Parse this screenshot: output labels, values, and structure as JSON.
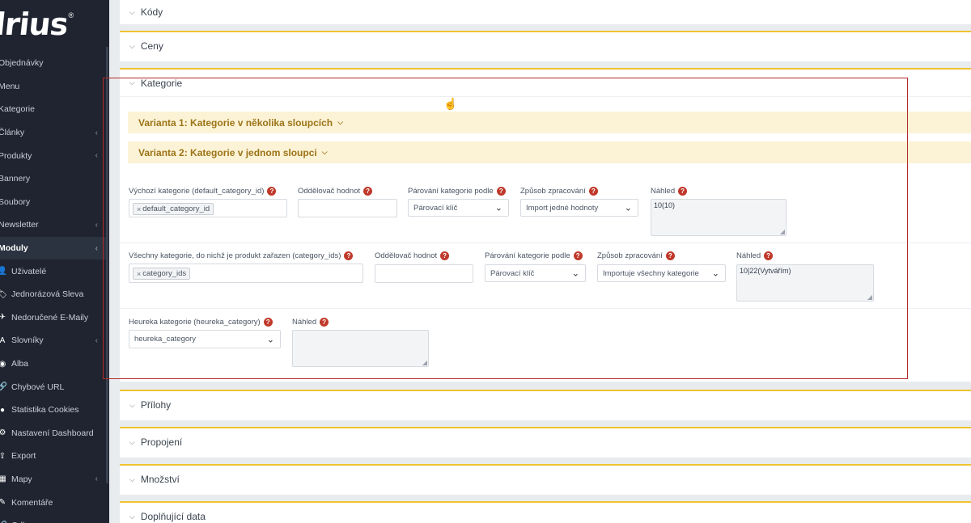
{
  "brand": {
    "logo_text": "lrius",
    "reg": "®"
  },
  "sidebar": {
    "items": [
      {
        "label": "Objednávky",
        "has_icon": false,
        "chevron": false
      },
      {
        "label": "Menu",
        "has_icon": false,
        "chevron": false
      },
      {
        "label": "Kategorie",
        "has_icon": false,
        "chevron": false
      },
      {
        "label": "Články",
        "has_icon": false,
        "chevron": true
      },
      {
        "label": "Produkty",
        "has_icon": false,
        "chevron": true
      },
      {
        "label": "Bannery",
        "has_icon": false,
        "chevron": false
      },
      {
        "label": "Soubory",
        "has_icon": false,
        "chevron": false
      },
      {
        "label": "Newsletter",
        "has_icon": false,
        "chevron": true
      },
      {
        "label": "Moduly",
        "has_icon": false,
        "chevron": true,
        "active": true
      },
      {
        "label": "Uživatelé",
        "has_icon": true,
        "icon": "user-icon",
        "chevron": false
      },
      {
        "label": "Jednorázová Sleva",
        "has_icon": true,
        "icon": "tag-icon",
        "chevron": false
      },
      {
        "label": "Nedoručené E-Maily",
        "has_icon": true,
        "icon": "send-icon",
        "chevron": false
      },
      {
        "label": "Slovníky",
        "has_icon": true,
        "icon": "translate-icon",
        "chevron": true
      },
      {
        "label": "Alba",
        "has_icon": true,
        "icon": "camera-icon",
        "chevron": false
      },
      {
        "label": "Chybové URL",
        "has_icon": true,
        "icon": "link-icon",
        "chevron": false
      },
      {
        "label": "Statistika Cookies",
        "has_icon": true,
        "icon": "cookie-icon",
        "chevron": false
      },
      {
        "label": "Nastavení Dashboard",
        "has_icon": true,
        "icon": "gear-icon",
        "chevron": false
      },
      {
        "label": "Export",
        "has_icon": true,
        "icon": "export-icon",
        "chevron": false
      },
      {
        "label": "Mapy",
        "has_icon": true,
        "icon": "map-icon",
        "chevron": true
      },
      {
        "label": "Komentáře",
        "has_icon": true,
        "icon": "comment-icon",
        "chevron": false
      },
      {
        "label": "Odkazy",
        "has_icon": true,
        "icon": "link-icon",
        "chevron": false
      }
    ]
  },
  "panels": {
    "kody": "Kódy",
    "ceny": "Ceny",
    "kategorie": "Kategorie",
    "prilohy": "Přílohy",
    "propojeni": "Propojení",
    "mnozstvi": "Množství",
    "doplnujici": "Doplňující data"
  },
  "variants": {
    "v1": "Varianta 1: Kategorie v několika sloupcích",
    "v2": "Varianta 2: Kategorie v jednom sloupci"
  },
  "row1": {
    "field_label": "Výchozí kategorie (default_category_id)",
    "tag": "default_category_id",
    "separator_label": "Oddělovač hodnot",
    "separator_value": "",
    "pairing_label": "Párování kategorie podle",
    "pairing_value": "Párovací klíč",
    "method_label": "Způsob zpracování",
    "method_value": "Import jedné hodnoty",
    "preview_label": "Náhled",
    "preview_value": "10(10)"
  },
  "row2": {
    "field_label": "Všechny kategorie, do nichž je produkt zařazen (category_ids)",
    "tag": "category_ids",
    "separator_label": "Oddělovač hodnot",
    "separator_value": "",
    "pairing_label": "Párování kategorie podle",
    "pairing_value": "Párovací klíč",
    "method_label": "Způsob zpracování",
    "method_value": "Importuje všechny kategorie",
    "preview_label": "Náhled",
    "preview_value": "10|22(Vytvářím)"
  },
  "row3": {
    "field_label": "Heureka kategorie (heureka_category)",
    "select_value": "heureka_category",
    "preview_label": "Náhled",
    "preview_value": ""
  },
  "colors": {
    "accent": "#f0c330",
    "variant_bg": "#fcf3d6",
    "variant_text": "#9c7418",
    "help": "#c0392b",
    "highlight_box": "#b32a2a"
  }
}
